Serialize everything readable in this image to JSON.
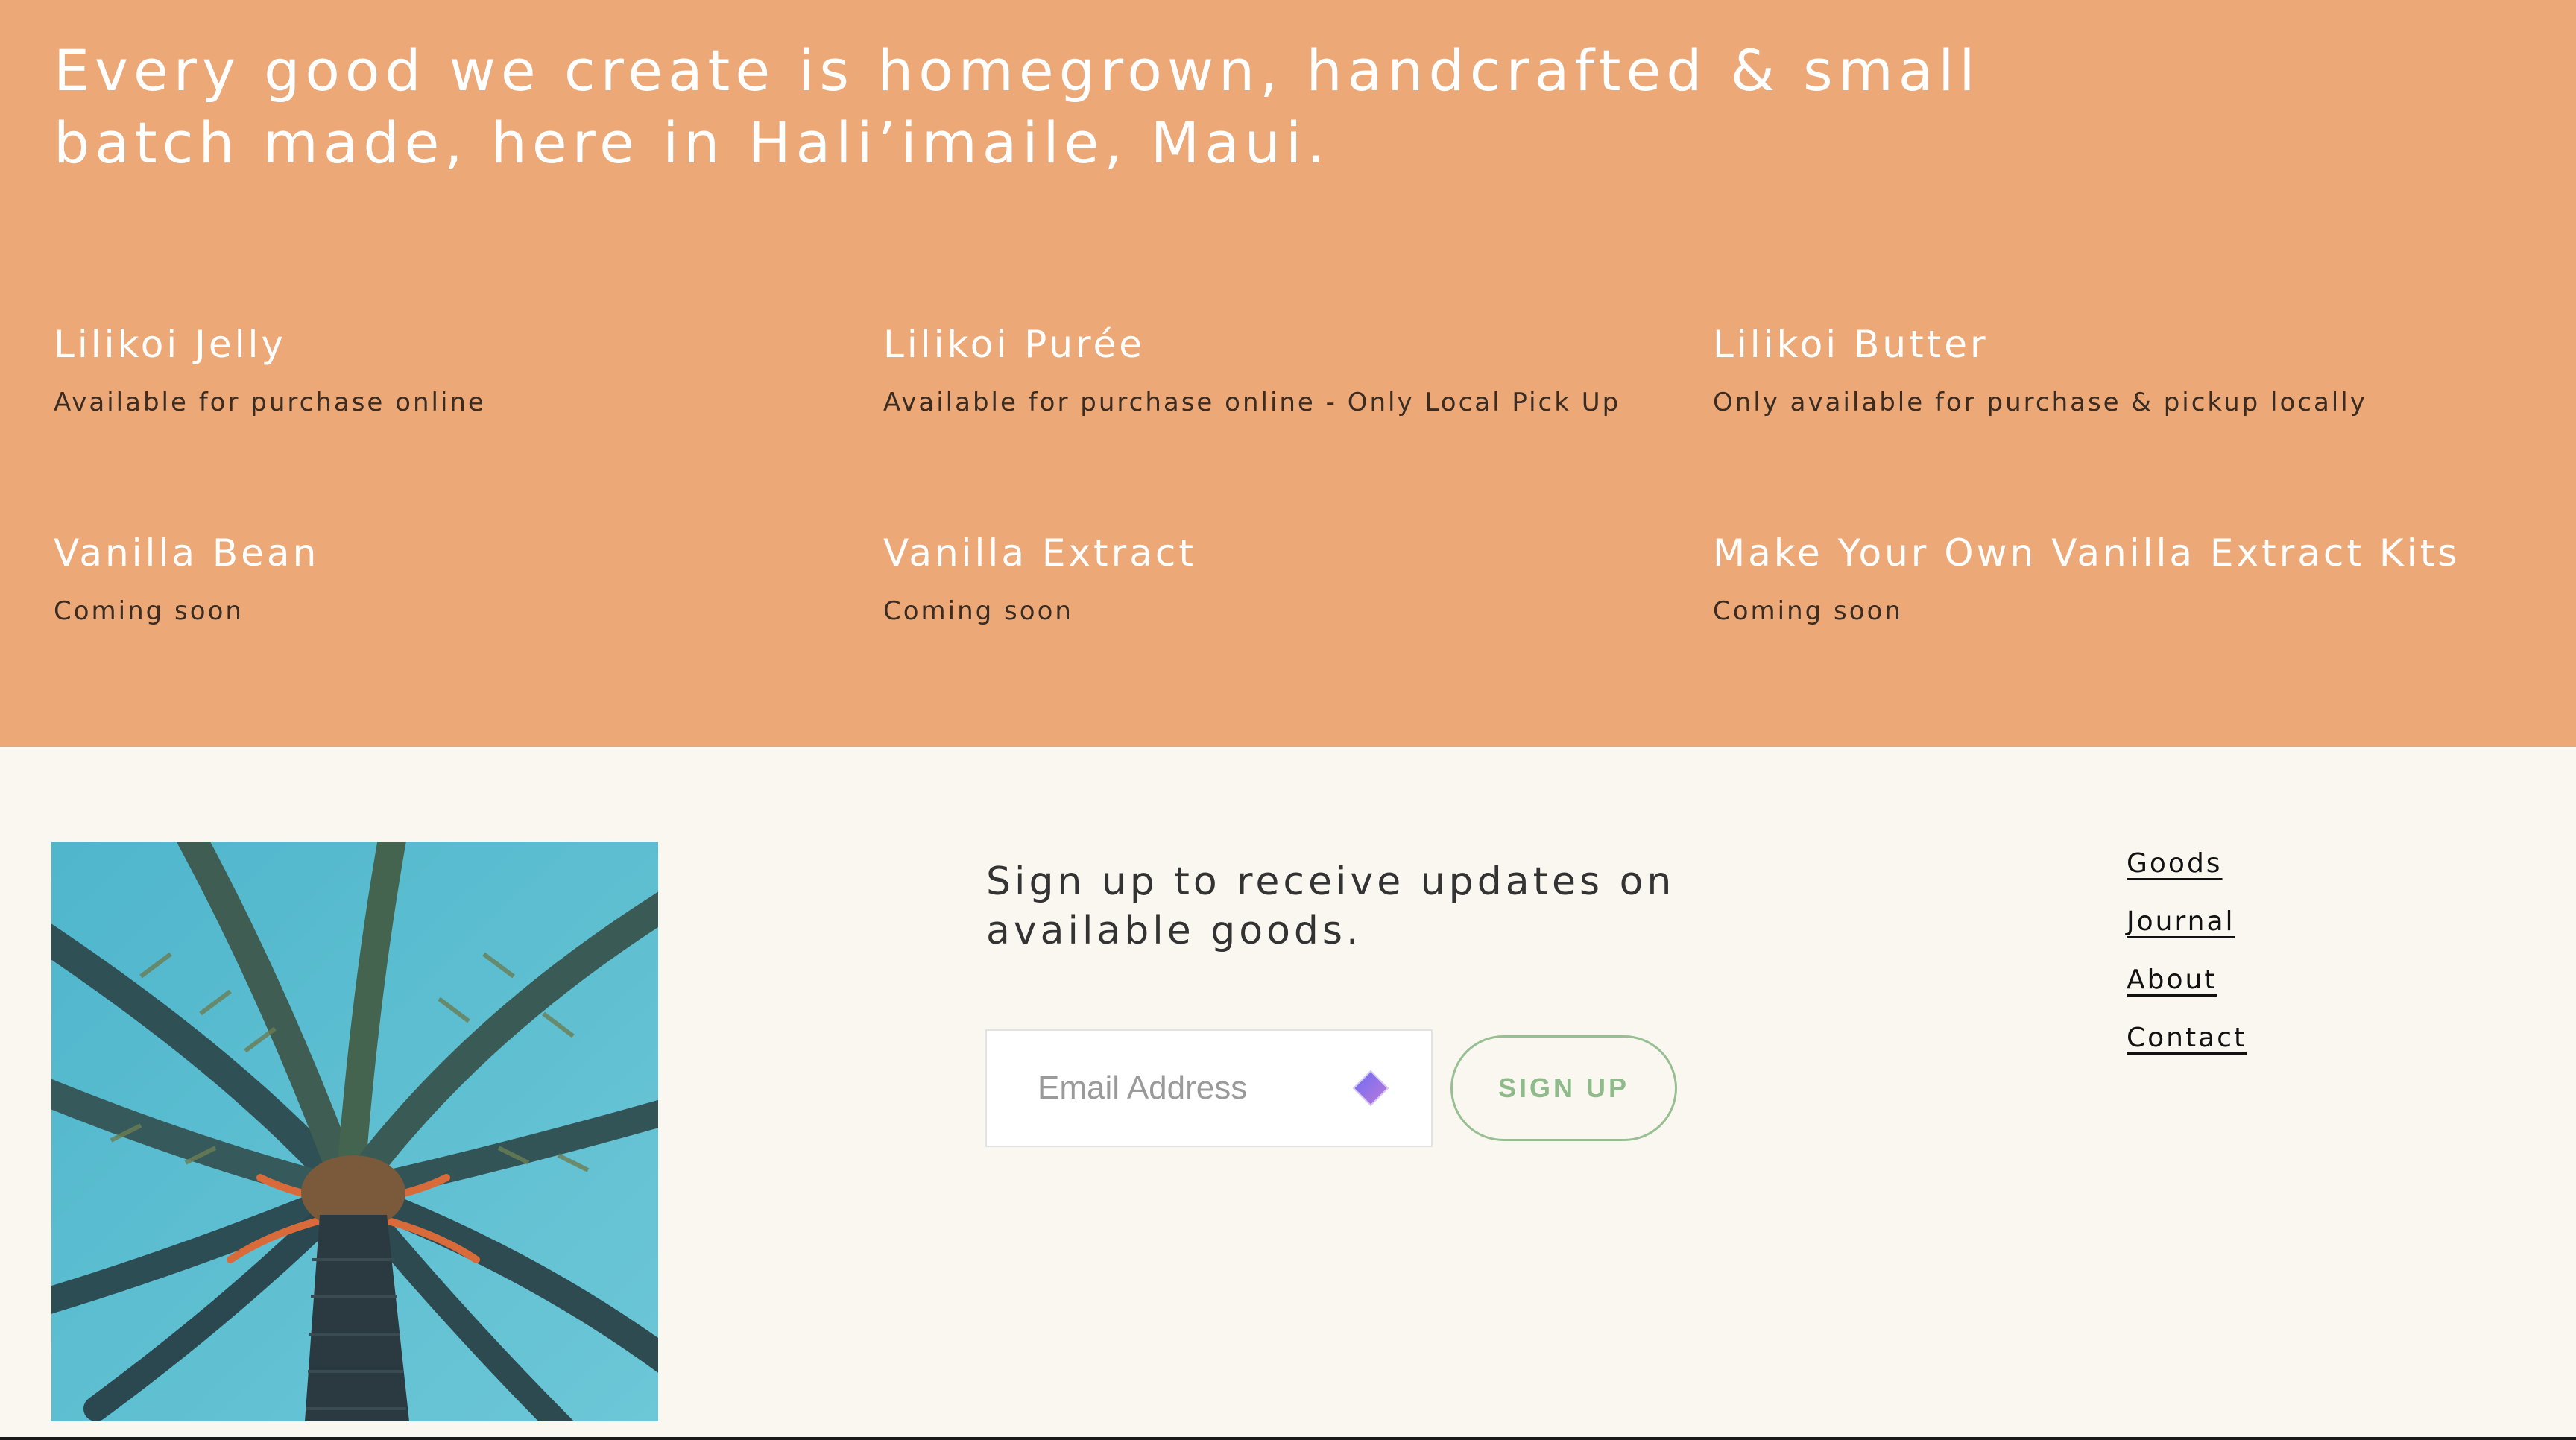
{
  "hero": {
    "headline": "Every good we create is homegrown, handcrafted & small batch made, here in Hali’imaile, Maui.",
    "background_color": "#eca977",
    "products": [
      {
        "name": "Lilikoi Jelly",
        "status": "Available for purchase online"
      },
      {
        "name": "Lilikoi Purée",
        "status": "Available for purchase online - Only Local Pick Up"
      },
      {
        "name": "Lilikoi Butter",
        "status": "Only available for purchase & pickup locally"
      },
      {
        "name": "Vanilla Bean",
        "status": "Coming soon"
      },
      {
        "name": "Vanilla Extract",
        "status": "Coming soon"
      },
      {
        "name": "Make Your Own Vanilla Extract Kits",
        "status": "Coming soon"
      }
    ]
  },
  "footer": {
    "image": {
      "subject": "palm-tree-photo"
    },
    "signup": {
      "heading": "Sign up to receive updates on available goods.",
      "email_placeholder": "Email Address",
      "button_label": "SIGN UP",
      "button_color": "#8fbb8a"
    },
    "nav": [
      {
        "label": "Goods"
      },
      {
        "label": "Journal"
      },
      {
        "label": "About"
      },
      {
        "label": "Contact"
      }
    ]
  }
}
